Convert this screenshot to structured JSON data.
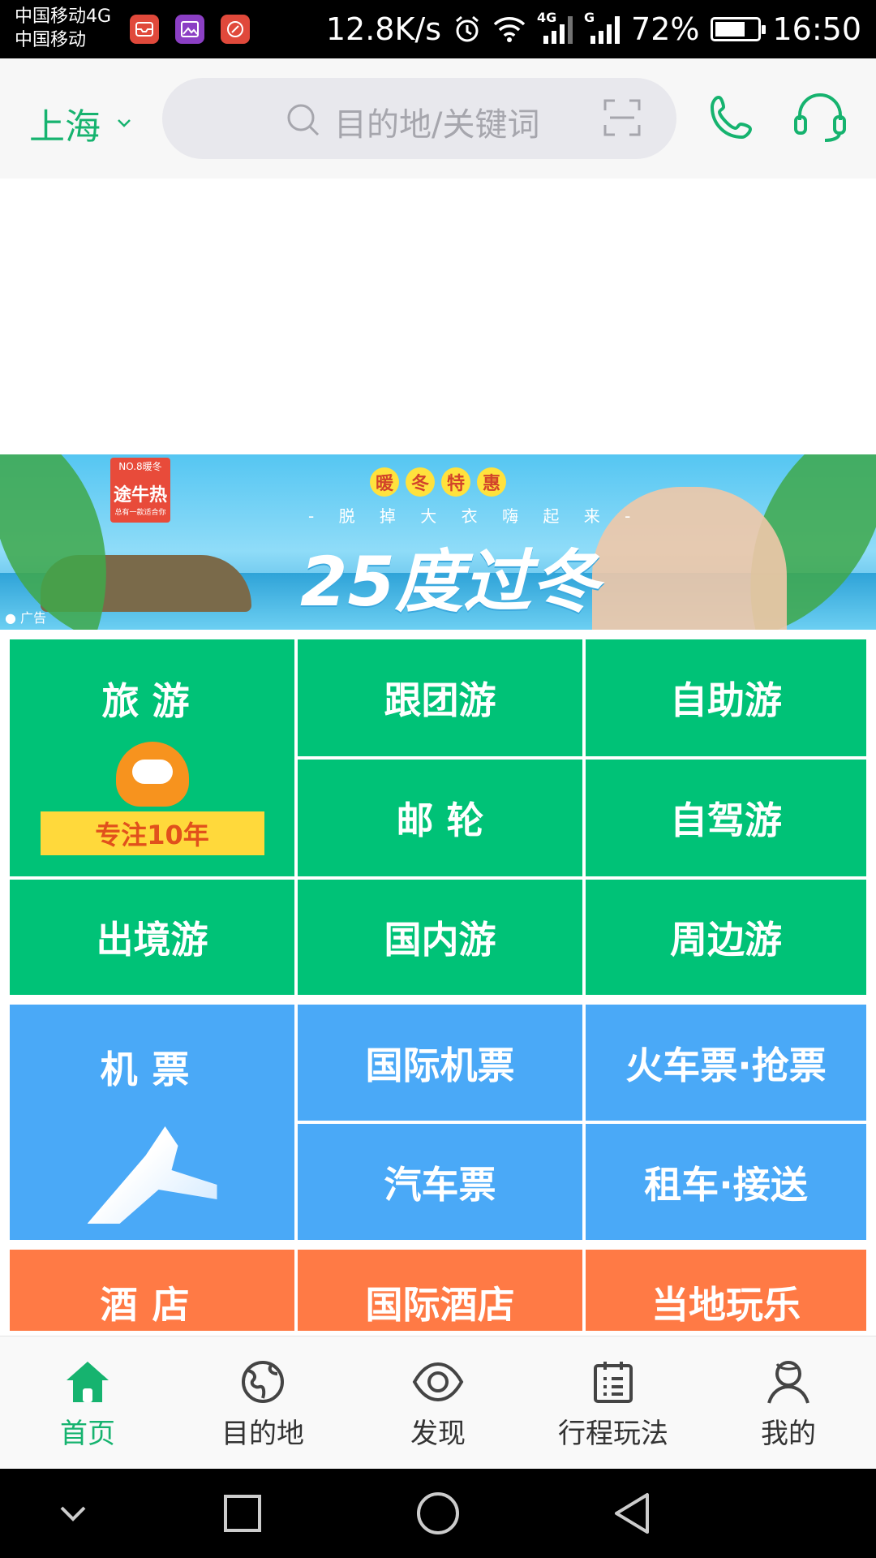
{
  "status_bar": {
    "carrier_line1": "中国移动4G",
    "carrier_line2": "中国移动",
    "net_speed": "12.8K/s",
    "net_type_1": "4G",
    "net_type_2": "G",
    "battery": "72%",
    "battery_level": 0.72,
    "time": "16:50"
  },
  "header": {
    "city": "上海",
    "search_placeholder": "目的地/关键词"
  },
  "banner": {
    "logo_top": "NO.8暖冬",
    "logo_main": "途牛热",
    "logo_sub": "总有一款适合你",
    "pills": [
      "暖",
      "冬",
      "特",
      "惠"
    ],
    "subtitle": "- 脱 掉 大 衣 嗨 起 来 -",
    "headline": "25度过冬",
    "ad_label": "广告"
  },
  "travel": {
    "main_label": "旅游",
    "badge": "专注10年",
    "items": [
      "跟团游",
      "自助游",
      "邮 轮",
      "自驾游",
      "出境游",
      "国内游",
      "周边游"
    ]
  },
  "tickets": {
    "main_label": "机票",
    "items": [
      "国际机票",
      "火车票·抢票",
      "汽车票",
      "租车·接送"
    ]
  },
  "hotel": {
    "main_label": "酒店",
    "items": [
      "国际酒店",
      "当地玩乐"
    ]
  },
  "tabbar": {
    "tabs": [
      {
        "label": "首页",
        "icon": "home-icon",
        "active": true
      },
      {
        "label": "目的地",
        "icon": "globe-icon",
        "active": false
      },
      {
        "label": "发现",
        "icon": "eye-icon",
        "active": false
      },
      {
        "label": "行程玩法",
        "icon": "itinerary-icon",
        "active": false
      },
      {
        "label": "我的",
        "icon": "user-icon",
        "active": false
      }
    ]
  },
  "colors": {
    "brand_green": "#16b36f",
    "travel_green": "#00c277",
    "ticket_blue": "#4aa9f7",
    "hotel_orange": "#ff7a45"
  }
}
